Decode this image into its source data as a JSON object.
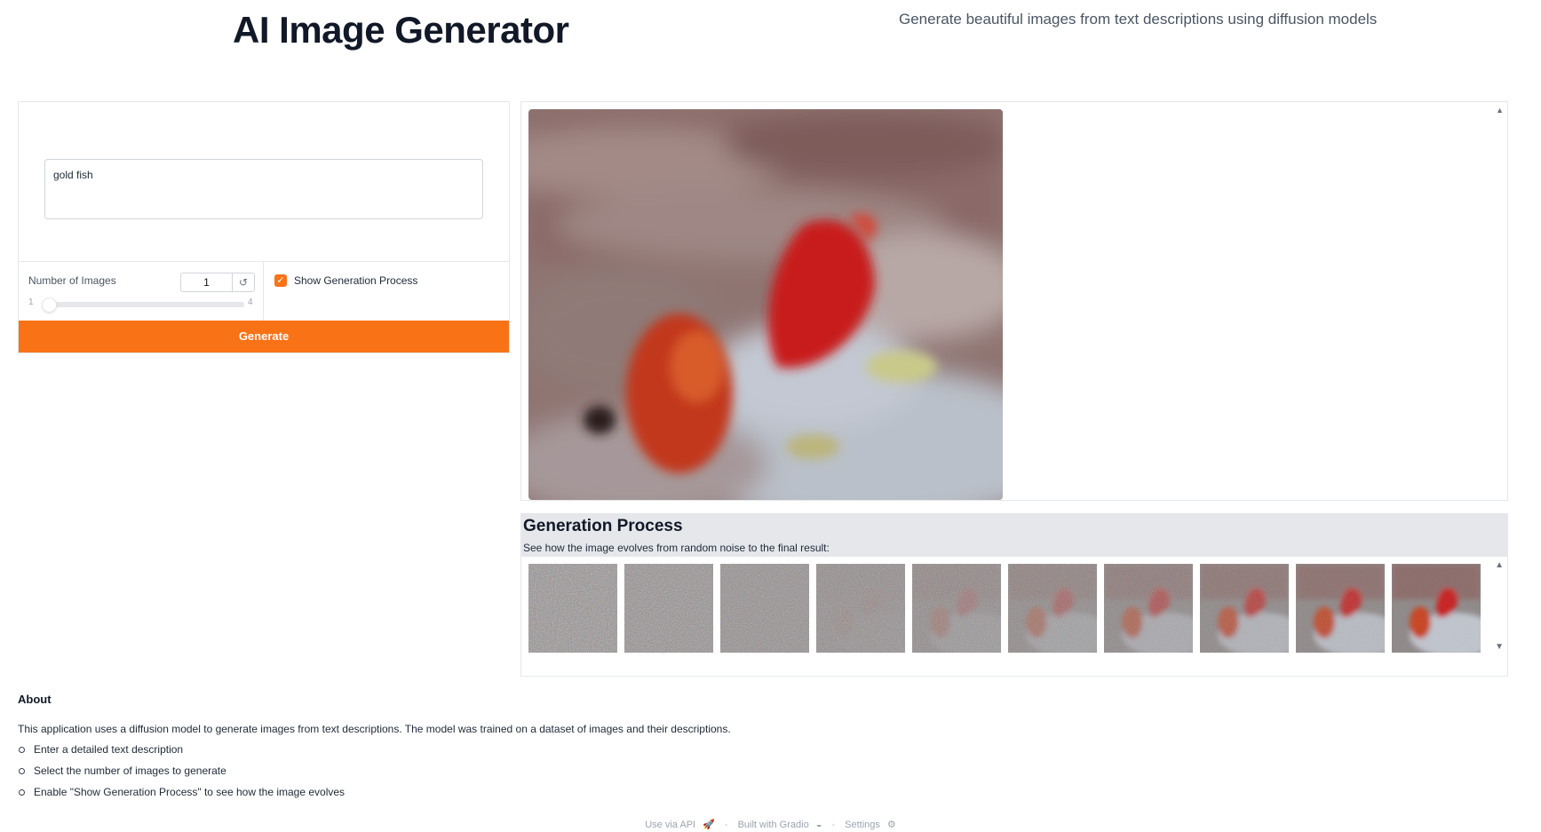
{
  "header": {
    "title": "AI Image Generator",
    "subtitle": "Generate beautiful images from text descriptions using diffusion models"
  },
  "prompt": {
    "value": "gold fish"
  },
  "num_images": {
    "label": "Number of Images",
    "value": "1",
    "min": "1",
    "max": "4",
    "reset_icon": "refresh-icon"
  },
  "show_process": {
    "label": "Show Generation Process",
    "checked": true
  },
  "generate_button": {
    "label": "Generate"
  },
  "process": {
    "title": "Generation Process",
    "description": "See how the image evolves from random noise to the final result:",
    "frame_count": 10
  },
  "about": {
    "title": "About",
    "text": "This application uses a diffusion model to generate images from text descriptions. The model was trained on a dataset of images and their descriptions.",
    "items": [
      "Enter a detailed text description",
      "Select the number of images to generate",
      "Enable \"Show Generation Process\" to see how the image evolves"
    ]
  },
  "footer": {
    "api": "Use via API",
    "sep": "·",
    "built": "Built with Gradio",
    "settings": "Settings"
  },
  "colors": {
    "accent": "#f97316",
    "panel_header": "#e5e7eb"
  }
}
